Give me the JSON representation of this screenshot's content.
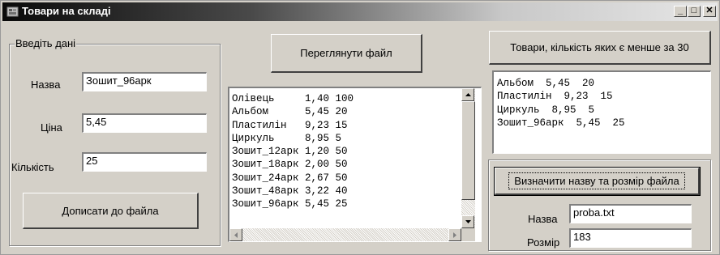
{
  "window": {
    "title": "Товари на складі",
    "controls": {
      "minimize": "_",
      "maximize": "□",
      "close": "✕"
    }
  },
  "input_group": {
    "legend": "Введіть дані",
    "name_label": "Назва",
    "name_value": "Зошит_96арк",
    "price_label": "Ціна",
    "price_value": "5,45",
    "qty_label": "Кількість",
    "qty_value": "25",
    "append_button": "Дописати до файла"
  },
  "view_file_button": "Переглянути файл",
  "file_memo": {
    "lines": [
      "Олівець     1,40 100",
      "Альбом      5,45 20",
      "Пластилін   9,23 15",
      "Циркуль     8,95 5",
      "Зошит_12арк 1,20 50",
      "Зошит_18арк 2,00 50",
      "Зошит_24арк 2,67 50",
      "Зошит_48арк 3,22 40",
      "Зошит_96арк 5,45 25"
    ]
  },
  "less30_button": "Товари, кількість яких є менше за 30",
  "result_memo": {
    "lines": [
      "Альбом  5,45  20",
      "Пластилін  9,23  15",
      "Циркуль  8,95  5",
      "Зошит_96арк  5,45  25"
    ]
  },
  "file_info_group": {
    "button": "Визначити назву та розмір файла",
    "name_label": "Назва",
    "name_value": "proba.txt",
    "size_label": "Розмір",
    "size_value": "183"
  }
}
